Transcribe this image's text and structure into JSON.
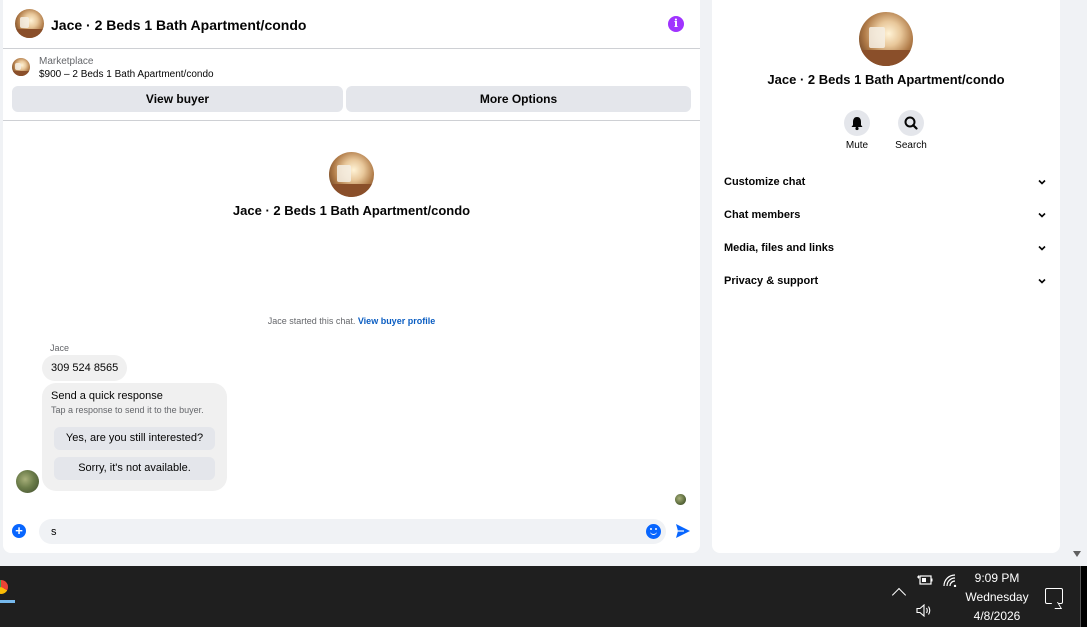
{
  "chat": {
    "header_title": "Jace · 2 Beds 1 Bath Apartment/condo",
    "info_symbol": "i",
    "listing": {
      "category": "Marketplace",
      "price_line": "$900 – 2 Beds 1 Bath Apartment/condo"
    },
    "buttons": {
      "view_buyer": "View buyer",
      "more_options": "More Options"
    },
    "center_title": "Jace · 2 Beds 1 Bath Apartment/condo",
    "started_text": "Jace started this chat.",
    "buyer_profile_link": "View buyer profile",
    "sender_name": "Jace",
    "message_phone": "309 524 8565",
    "quick_response": {
      "title": "Send a quick response",
      "subtitle": "Tap a response to send it to the buyer.",
      "option_1": "Yes, are you still interested?",
      "option_2": "Sorry, it's not available."
    },
    "composer": {
      "value": "s"
    }
  },
  "info_panel": {
    "title": "Jace · 2 Beds 1 Bath Apartment/condo",
    "mute_label": "Mute",
    "search_label": "Search",
    "sections": [
      "Customize chat",
      "Chat members",
      "Media, files and links",
      "Privacy & support"
    ]
  },
  "taskbar": {
    "time": "9:09 PM",
    "day": "Wednesday",
    "date": "4/8/2026"
  },
  "colors": {
    "accent_blue": "#0866ff",
    "info_purple": "#a033ff",
    "link_blue": "#0a5dc2"
  }
}
